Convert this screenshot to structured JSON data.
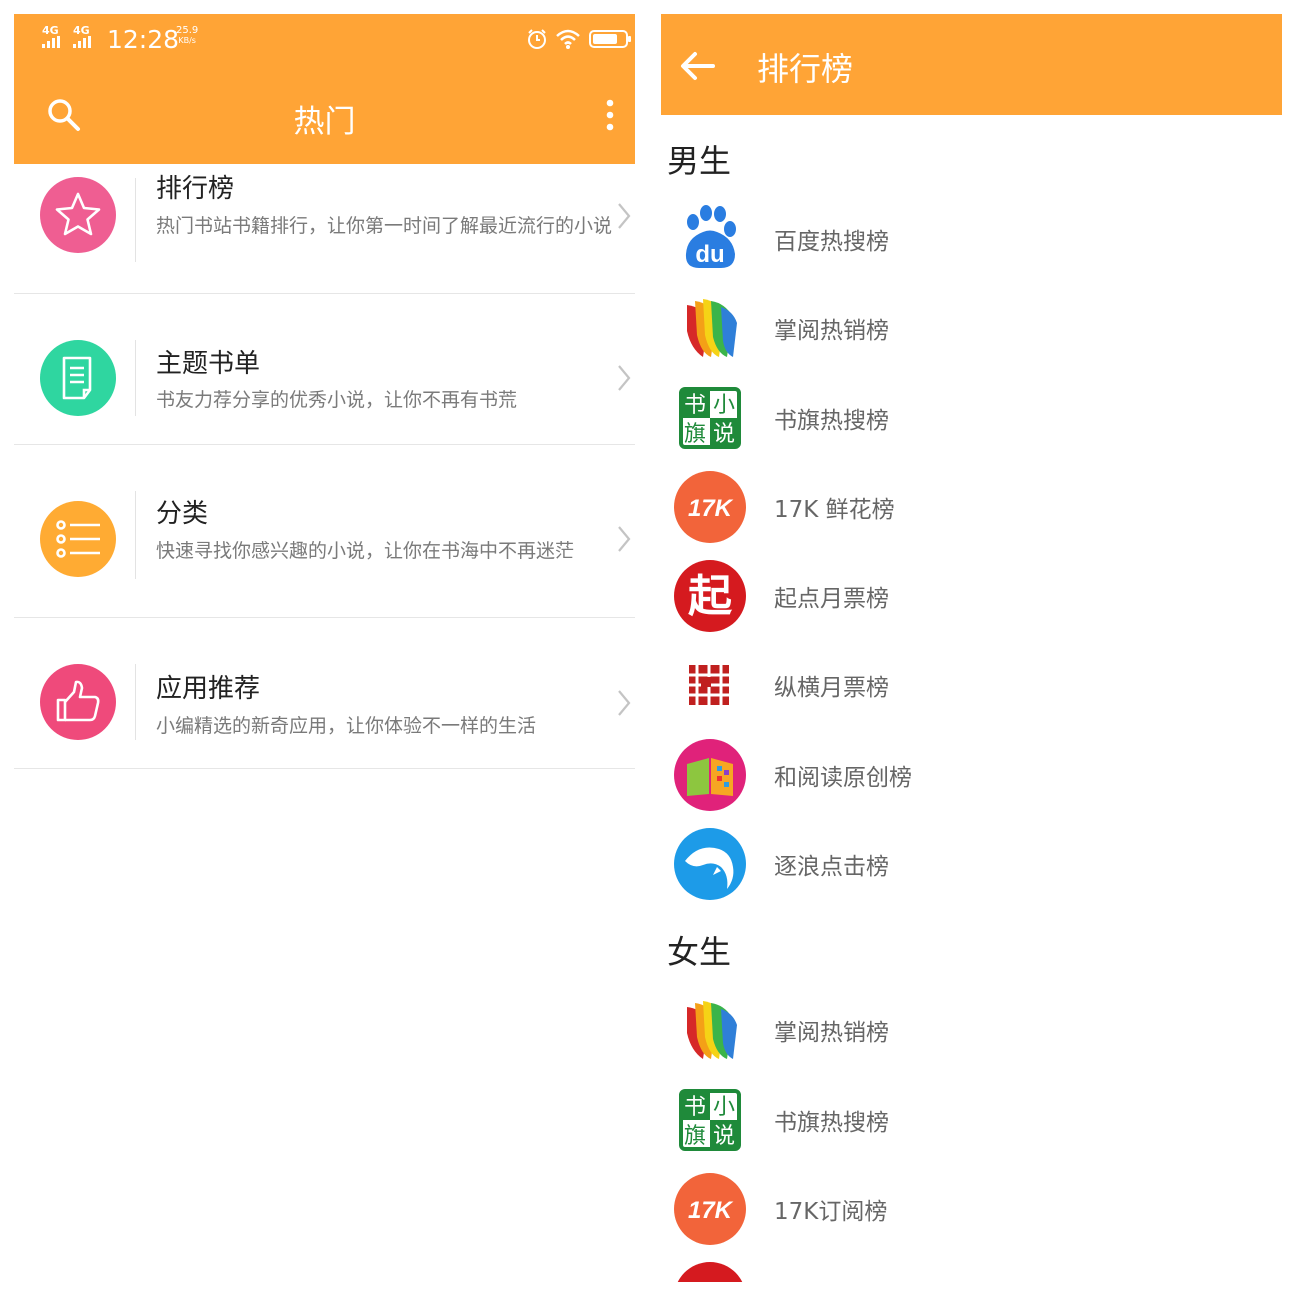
{
  "left": {
    "status_bar": {
      "network_1": "4G",
      "network_2": "4G",
      "time": "12:28",
      "speed_value": "25.9",
      "speed_unit": "KB/s"
    },
    "toolbar": {
      "title": "热门"
    },
    "menu_items": [
      {
        "title": "排行榜",
        "desc": "热门书站书籍排行，让你第一时间了解最近流行的小说",
        "icon": "star-icon",
        "color": "#ef5e92"
      },
      {
        "title": "主题书单",
        "desc": "书友力荐分享的优秀小说，让你不再有书荒",
        "icon": "document-icon",
        "color": "#2fd6a0"
      },
      {
        "title": "分类",
        "desc": "快速寻找你感兴趣的小说，让你在书海中不再迷茫",
        "icon": "list-icon",
        "color": "#ffab33"
      },
      {
        "title": "应用推荐",
        "desc": "小编精选的新奇应用，让你体验不一样的生活",
        "icon": "thumbs-up-icon",
        "color": "#ef4a7b"
      }
    ]
  },
  "right": {
    "toolbar": {
      "title": "排行榜"
    },
    "sections": [
      {
        "title": "男生",
        "items": [
          {
            "label": "百度热搜榜",
            "icon": "baidu-icon"
          },
          {
            "label": "掌阅热销榜",
            "icon": "zhangyue-icon"
          },
          {
            "label": "书旗热搜榜",
            "icon": "shuqi-icon"
          },
          {
            "label": "17K 鲜花榜",
            "icon": "17k-icon"
          },
          {
            "label": "起点月票榜",
            "icon": "qidian-icon"
          },
          {
            "label": "纵横月票榜",
            "icon": "zongheng-icon"
          },
          {
            "label": "和阅读原创榜",
            "icon": "heyuedu-icon"
          },
          {
            "label": "逐浪点击榜",
            "icon": "zhulang-icon"
          }
        ]
      },
      {
        "title": "女生",
        "items": [
          {
            "label": "掌阅热销榜",
            "icon": "zhangyue-icon"
          },
          {
            "label": "书旗热搜榜",
            "icon": "shuqi-icon"
          },
          {
            "label": "17K订阅榜",
            "icon": "17k-icon"
          }
        ]
      }
    ],
    "logo_text": {
      "baidu": "du",
      "k17": "17K",
      "shuqi": [
        "书",
        "小",
        "旗",
        "说"
      ],
      "qidian": "起"
    }
  },
  "colors": {
    "accent": "#ffa436"
  }
}
